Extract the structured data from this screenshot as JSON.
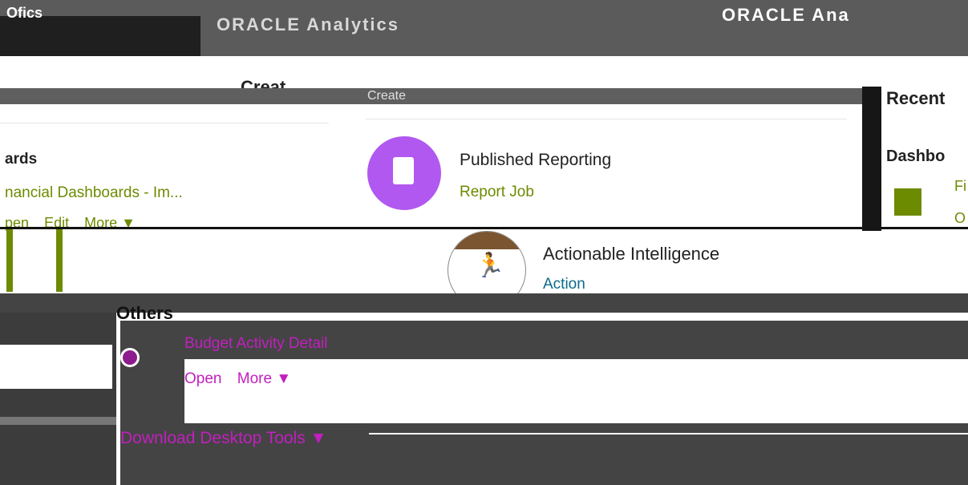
{
  "header": {
    "left_text": "Ofics",
    "brand": "ORACLE Analytics",
    "right_text": "ORACLE Ana"
  },
  "create": {
    "title": "Creat",
    "bar_label": "Create"
  },
  "left_panel": {
    "title": "ards",
    "link": "nancial Dashboards - Im...",
    "actions": [
      "pen",
      "Edit",
      "More ▼"
    ]
  },
  "published_reporting": {
    "title": "Published Reporting",
    "link": "Report Job"
  },
  "actionable_intelligence": {
    "title": "Actionable Intelligence",
    "link": "Action"
  },
  "recent": {
    "title": "Recent",
    "subtitle": "Dashbo",
    "link1": "Fi",
    "link2": "O"
  },
  "others": {
    "title": "Others",
    "item_title": "Budget Activity Detail",
    "item_actions": [
      "Open",
      "More ▼"
    ],
    "download": "Download Desktop Tools ▼"
  }
}
